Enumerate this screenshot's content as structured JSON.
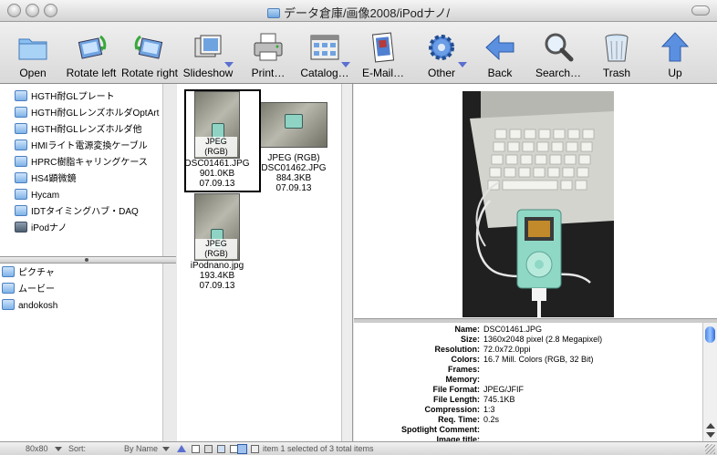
{
  "window": {
    "title": "データ倉庫/画像2008/iPodナノ/"
  },
  "toolbar": {
    "items": [
      {
        "label": "Open",
        "icon": "folder-icon"
      },
      {
        "label": "Rotate left",
        "icon": "rotate-left-icon"
      },
      {
        "label": "Rotate right",
        "icon": "rotate-right-icon"
      },
      {
        "label": "Slideshow",
        "icon": "slideshow-icon"
      },
      {
        "label": "Print…",
        "icon": "printer-icon"
      },
      {
        "label": "Catalog…",
        "icon": "catalog-icon"
      },
      {
        "label": "E-Mail…",
        "icon": "email-icon"
      },
      {
        "label": "Other",
        "icon": "gear-icon"
      },
      {
        "label": "Back",
        "icon": "back-arrow-icon"
      },
      {
        "label": "Search…",
        "icon": "magnifier-icon"
      },
      {
        "label": "Trash",
        "icon": "trash-icon"
      },
      {
        "label": "Up",
        "icon": "up-arrow-icon"
      }
    ]
  },
  "folder_tree": {
    "items": [
      "HGTH耐GLプレート",
      "HGTH耐GLレンズホルダOptArt",
      "HGTH耐GLレンズホルダ他",
      "HMIライト電源変換ケーブル",
      "HPRC樹脂キャリングケース",
      "HS4顕微鏡",
      "Hycam",
      "IDTタイミングハブ・DAQ",
      "iPodナノ"
    ]
  },
  "favorites": {
    "items": [
      "ピクチャ",
      "ムービー",
      "andokosh"
    ]
  },
  "thumbnails": [
    {
      "tag": "JPEG (RGB)",
      "name": "DSC01461.JPG",
      "size": "901.0KB",
      "date": "07.09.13"
    },
    {
      "tag": "JPEG (RGB)",
      "name": "DSC01462.JPG",
      "size": "884.3KB",
      "date": "07.09.13"
    },
    {
      "tag": "JPEG (RGB)",
      "name": "iPodnano.jpg",
      "size": "193.4KB",
      "date": "07.09.13"
    }
  ],
  "info": {
    "rows": [
      {
        "k": "Name:",
        "v": "DSC01461.JPG"
      },
      {
        "k": "Size:",
        "v": "1360x2048 pixel (2.8 Megapixel)"
      },
      {
        "k": "Resolution:",
        "v": "72.0x72.0ppi"
      },
      {
        "k": "Colors:",
        "v": "16.7 Mill. Colors (RGB, 32 Bit)"
      },
      {
        "k": "Frames:",
        "v": ""
      },
      {
        "k": "Memory:",
        "v": ""
      },
      {
        "k": "File Format:",
        "v": "JPEG/JFIF"
      },
      {
        "k": "File Length:",
        "v": "745.1KB"
      },
      {
        "k": "Compression:",
        "v": "1:3"
      },
      {
        "k": "Req. Time:",
        "v": "0.2s"
      },
      {
        "k": "Spotlight Comment:",
        "v": ""
      },
      {
        "k": "Image title:",
        "v": ""
      }
    ]
  },
  "statusbar": {
    "thumb_size": "80x80",
    "sort_label": "Sort:",
    "sort_value": "By Name",
    "status_text": "item 1 selected of 3 total items"
  },
  "colors": {
    "accent": "#3d7ae0",
    "folder": "#7fb3e8"
  }
}
